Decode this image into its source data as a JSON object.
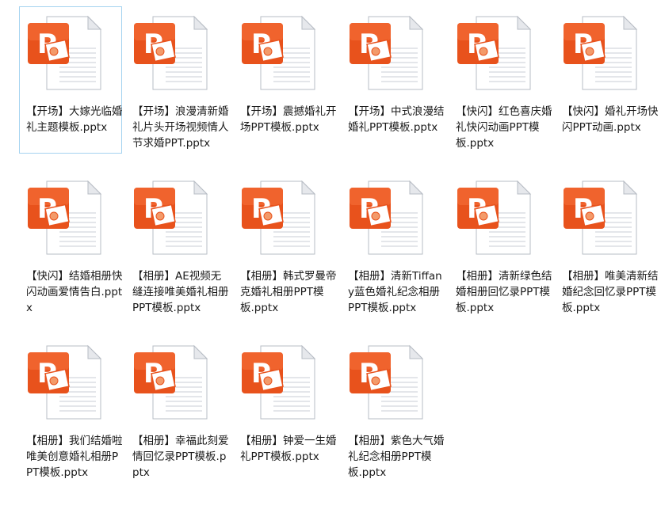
{
  "files": [
    {
      "name": "【开场】大嫁光临婚礼主题模板.pptx",
      "icon": "powerpoint-file-icon",
      "selected": true
    },
    {
      "name": "【开场】浪漫清新婚礼片头开场视频情人节求婚PPT.pptx",
      "icon": "powerpoint-file-icon",
      "selected": false
    },
    {
      "name": "【开场】震撼婚礼开场PPT模板.pptx",
      "icon": "powerpoint-file-icon",
      "selected": false
    },
    {
      "name": "【开场】中式浪漫结婚礼PPT模板.pptx",
      "icon": "powerpoint-file-icon",
      "selected": false
    },
    {
      "name": "【快闪】红色喜庆婚礼快闪动画PPT模板.pptx",
      "icon": "powerpoint-file-icon",
      "selected": false
    },
    {
      "name": "【快闪】婚礼开场快闪PPT动画.pptx",
      "icon": "powerpoint-file-icon",
      "selected": false
    },
    {
      "name": "【快闪】结婚相册快闪动画爱情告白.pptx",
      "icon": "powerpoint-file-icon",
      "selected": false
    },
    {
      "name": "【相册】AE视频无缝连接唯美婚礼相册PPT模板.pptx",
      "icon": "powerpoint-file-icon",
      "selected": false
    },
    {
      "name": "【相册】韩式罗曼帝克婚礼相册PPT模板.pptx",
      "icon": "powerpoint-file-icon",
      "selected": false
    },
    {
      "name": "【相册】清新Tiffany蓝色婚礼纪念相册PPT模板.pptx",
      "icon": "powerpoint-file-icon",
      "selected": false
    },
    {
      "name": "【相册】清新绿色结婚相册回忆录PPT模板.pptx",
      "icon": "powerpoint-file-icon",
      "selected": false
    },
    {
      "name": "【相册】唯美清新结婚纪念回忆录PPT模板.pptx",
      "icon": "powerpoint-file-icon",
      "selected": false
    },
    {
      "name": "【相册】我们结婚啦唯美创意婚礼相册PPT模板.pptx",
      "icon": "powerpoint-file-icon",
      "selected": false
    },
    {
      "name": "【相册】幸福此刻爱情回忆录PPT模板.pptx",
      "icon": "powerpoint-file-icon",
      "selected": false
    },
    {
      "name": "【相册】钟爱一生婚礼PPT模板.pptx",
      "icon": "powerpoint-file-icon",
      "selected": false
    },
    {
      "name": "【相册】紫色大气婚礼纪念相册PPT模板.pptx",
      "icon": "powerpoint-file-icon",
      "selected": false
    }
  ],
  "colors": {
    "accent_orange": "#e8521c",
    "selection_border": "#a5d3f0"
  }
}
